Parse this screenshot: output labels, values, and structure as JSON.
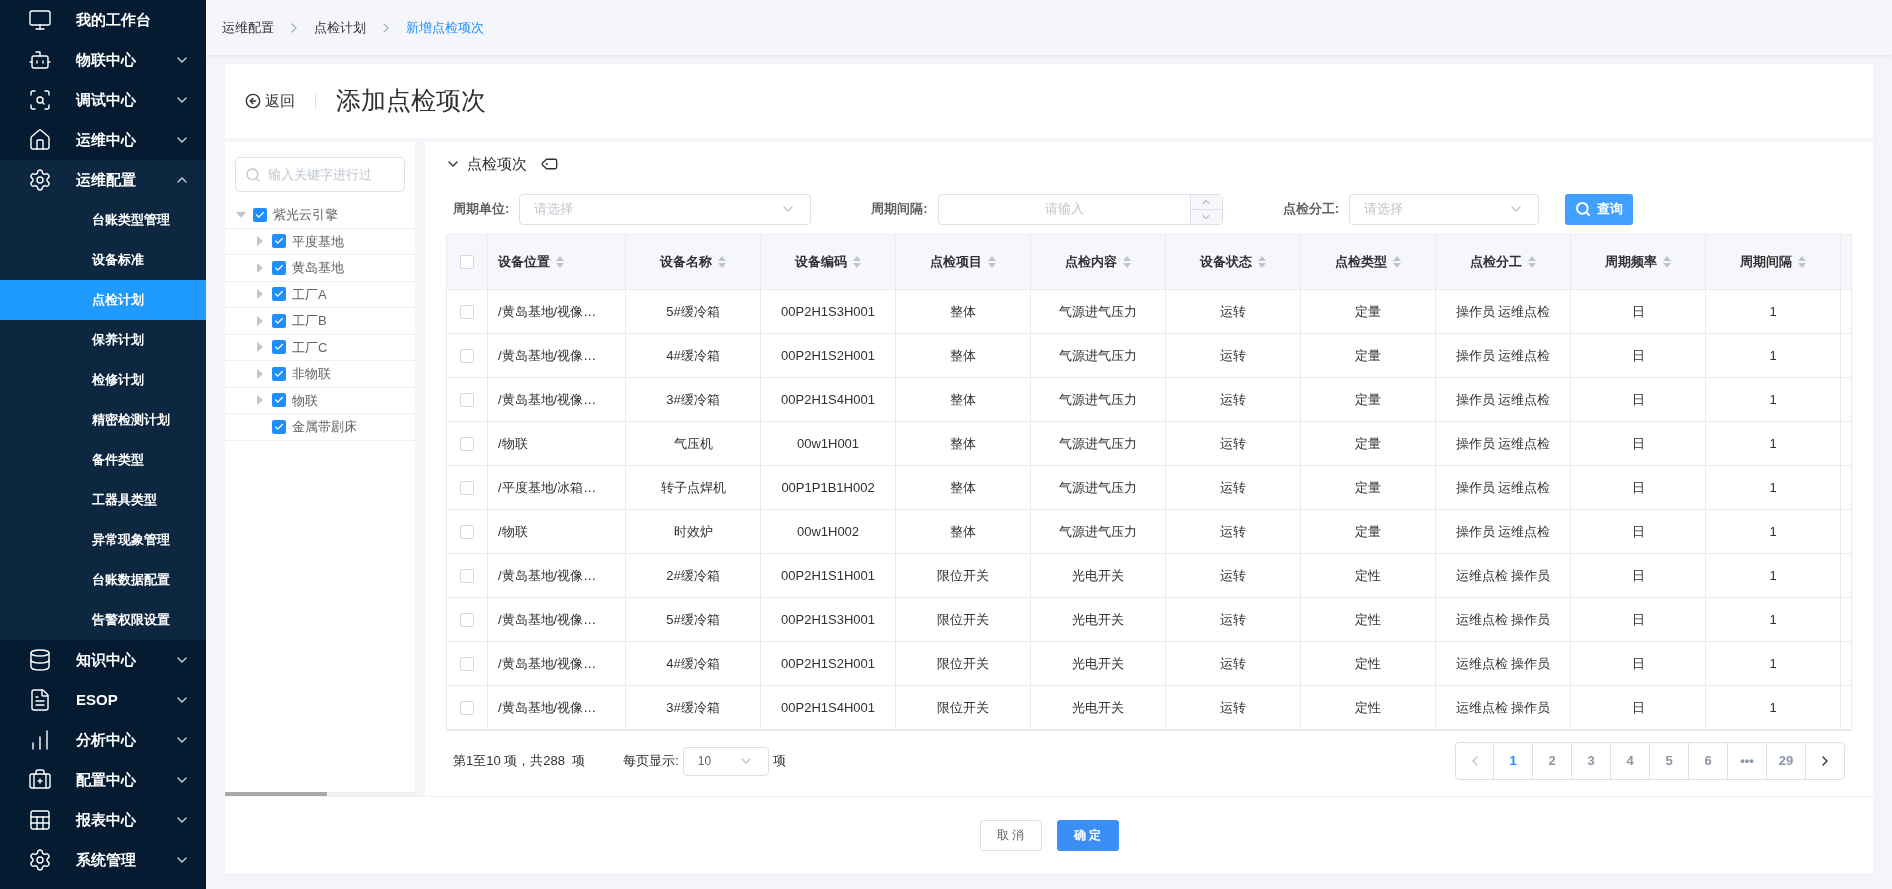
{
  "sidebar": {
    "items": [
      {
        "label": "我的工作台",
        "selected": false
      },
      {
        "label": "物联中心",
        "expanded": false,
        "selected": false
      },
      {
        "label": "调试中心",
        "expanded": false,
        "selected": false
      },
      {
        "label": "运维中心",
        "expanded": false,
        "selected": false
      },
      {
        "label": "运维配置",
        "expanded": true,
        "selected": false,
        "children": [
          {
            "label": "台账类型管理",
            "selected": false
          },
          {
            "label": "设备标准",
            "selected": false
          },
          {
            "label": "点检计划",
            "selected": true
          },
          {
            "label": "保养计划",
            "selected": false
          },
          {
            "label": "检修计划",
            "selected": false
          },
          {
            "label": "精密检测计划",
            "selected": false
          },
          {
            "label": "备件类型",
            "selected": false
          },
          {
            "label": "工器具类型",
            "selected": false
          },
          {
            "label": "异常现象管理",
            "selected": false
          },
          {
            "label": "台账数据配置",
            "selected": false
          },
          {
            "label": "告警权限设置",
            "selected": false
          }
        ]
      },
      {
        "label": "知识中心",
        "expanded": false,
        "selected": false
      },
      {
        "label": "ESOP",
        "expanded": false,
        "selected": false
      },
      {
        "label": "分析中心",
        "expanded": false,
        "selected": false
      },
      {
        "label": "配置中心",
        "expanded": false,
        "selected": false
      },
      {
        "label": "报表中心",
        "expanded": false,
        "selected": false
      },
      {
        "label": "系统管理",
        "expanded": false,
        "selected": false
      }
    ]
  },
  "breadcrumb": [
    "运维配置",
    "点检计划",
    "新增点检项次"
  ],
  "page": {
    "back": "返回",
    "title": "添加点检项次"
  },
  "tree": {
    "search_placeholder": "输入关键字进行过",
    "nodes": [
      {
        "label": "紫光云引擎",
        "checked": true,
        "expanded": true,
        "children": [
          {
            "label": "平度基地",
            "checked": true,
            "has_children": true
          },
          {
            "label": "黄岛基地",
            "checked": true,
            "has_children": true
          },
          {
            "label": "工厂A",
            "checked": true,
            "has_children": true
          },
          {
            "label": "工厂B",
            "checked": true,
            "has_children": true
          },
          {
            "label": "工厂C",
            "checked": true,
            "has_children": true
          },
          {
            "label": "非物联",
            "checked": true,
            "has_children": true
          },
          {
            "label": "物联",
            "checked": true,
            "has_children": true
          },
          {
            "label": "金属带剧床",
            "checked": true,
            "has_children": false
          }
        ]
      }
    ]
  },
  "section": {
    "title": "点检项次",
    "expanded": true
  },
  "filters": [
    {
      "kind": "select",
      "label": "周期单位:",
      "placeholder": "请选择"
    },
    {
      "kind": "number",
      "label": "周期间隔:",
      "placeholder": "请输入"
    },
    {
      "kind": "select",
      "label": "点检分工:",
      "placeholder": "请选择"
    }
  ],
  "query_button": "查询",
  "table": {
    "all_selected": false,
    "columns": [
      "设备位置",
      "设备名称",
      "设备编码",
      "点检项目",
      "点检内容",
      "设备状态",
      "点检类型",
      "点检分工",
      "周期频率",
      "周期间隔"
    ],
    "rows": [
      {
        "selected": false,
        "cells": [
          "/黄岛基地/视像…",
          "5#缓冷箱",
          "00P2H1S3H001",
          "整体",
          "气源进气压力",
          "运转",
          "定量",
          "操作员 运维点检",
          "日",
          "1"
        ]
      },
      {
        "selected": false,
        "cells": [
          "/黄岛基地/视像…",
          "4#缓冷箱",
          "00P2H1S2H001",
          "整体",
          "气源进气压力",
          "运转",
          "定量",
          "操作员 运维点检",
          "日",
          "1"
        ]
      },
      {
        "selected": false,
        "cells": [
          "/黄岛基地/视像…",
          "3#缓冷箱",
          "00P2H1S4H001",
          "整体",
          "气源进气压力",
          "运转",
          "定量",
          "操作员 运维点检",
          "日",
          "1"
        ]
      },
      {
        "selected": false,
        "cells": [
          "/物联",
          "气压机",
          "00w1H001",
          "整体",
          "气源进气压力",
          "运转",
          "定量",
          "操作员 运维点检",
          "日",
          "1"
        ]
      },
      {
        "selected": false,
        "cells": [
          "/平度基地/冰箱…",
          "转子点焊机",
          "00P1P1B1H002",
          "整体",
          "气源进气压力",
          "运转",
          "定量",
          "操作员 运维点检",
          "日",
          "1"
        ]
      },
      {
        "selected": false,
        "cells": [
          "/物联",
          "时效炉",
          "00w1H002",
          "整体",
          "气源进气压力",
          "运转",
          "定量",
          "操作员 运维点检",
          "日",
          "1"
        ]
      },
      {
        "selected": false,
        "cells": [
          "/黄岛基地/视像…",
          "2#缓冷箱",
          "00P2H1S1H001",
          "限位开关",
          "光电开关",
          "运转",
          "定性",
          "运维点检 操作员",
          "日",
          "1"
        ]
      },
      {
        "selected": false,
        "cells": [
          "/黄岛基地/视像…",
          "5#缓冷箱",
          "00P2H1S3H001",
          "限位开关",
          "光电开关",
          "运转",
          "定性",
          "运维点检 操作员",
          "日",
          "1"
        ]
      },
      {
        "selected": false,
        "cells": [
          "/黄岛基地/视像…",
          "4#缓冷箱",
          "00P2H1S2H001",
          "限位开关",
          "光电开关",
          "运转",
          "定性",
          "运维点检 操作员",
          "日",
          "1"
        ]
      },
      {
        "selected": false,
        "cells": [
          "/黄岛基地/视像…",
          "3#缓冷箱",
          "00P2H1S4H001",
          "限位开关",
          "光电开关",
          "运转",
          "定性",
          "运维点检 操作员",
          "日",
          "1"
        ]
      }
    ]
  },
  "pagination": {
    "summary": "第1至10 项，共288  项",
    "per_page_label": "每页显示:",
    "per_page": "10",
    "per_page_unit": "项",
    "pages": [
      {
        "label": "1",
        "selected": true
      },
      {
        "label": "2",
        "selected": false
      },
      {
        "label": "3",
        "selected": false
      },
      {
        "label": "4",
        "selected": false
      },
      {
        "label": "5",
        "selected": false
      },
      {
        "label": "6",
        "selected": false
      },
      {
        "label": "•••",
        "selected": false
      },
      {
        "label": "29",
        "selected": false
      }
    ]
  },
  "actions": {
    "cancel": "取 消",
    "confirm": "确 定"
  }
}
